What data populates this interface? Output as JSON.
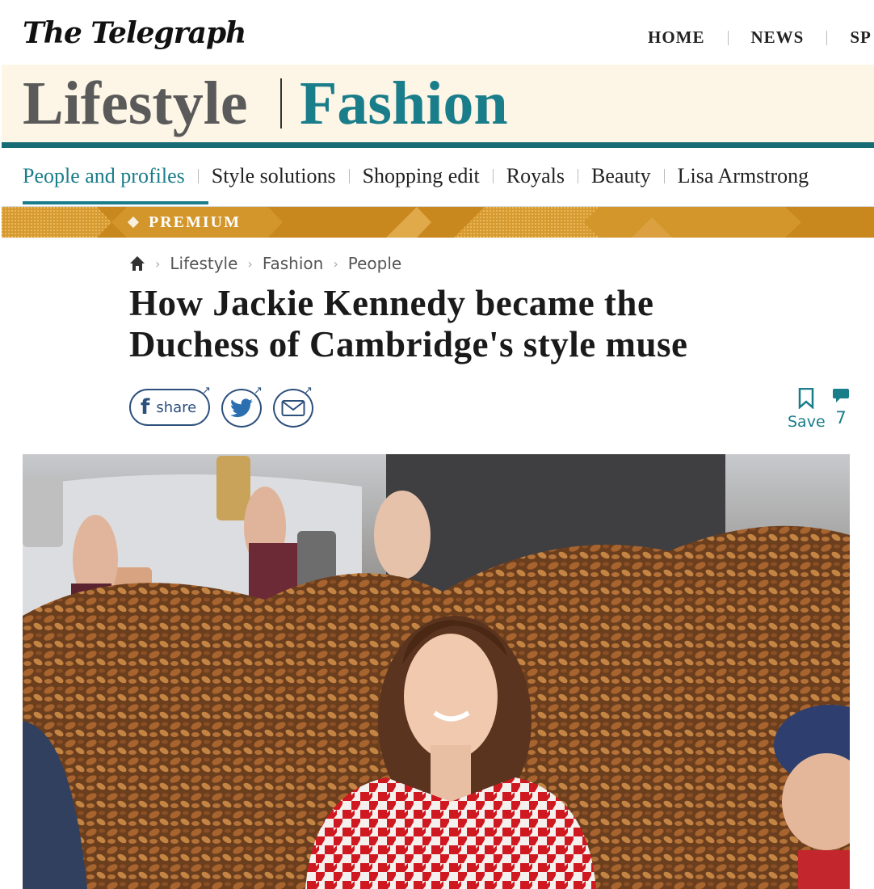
{
  "brand": {
    "logo": "The Telegraph"
  },
  "topnav": {
    "items": [
      "HOME",
      "NEWS",
      "SP"
    ]
  },
  "section": {
    "primary": "Lifestyle",
    "secondary": "Fashion"
  },
  "subnav": {
    "items": [
      "People and profiles",
      "Style solutions",
      "Shopping edit",
      "Royals",
      "Beauty",
      "Lisa Armstrong"
    ],
    "active": "People and profiles"
  },
  "premium": {
    "label": "PREMIUM"
  },
  "breadcrumb": {
    "items": [
      "Lifestyle",
      "Fashion",
      "People"
    ]
  },
  "article": {
    "headline_line1": "How Jackie Kennedy became the",
    "headline_line2": "Duchess of Cambridge's style muse"
  },
  "share": {
    "facebook_label": "share",
    "save_label": "Save",
    "comment_count": "7"
  },
  "colors": {
    "accent": "#1a7d8a",
    "premium": "#c9881e",
    "section_bg": "#fdf5e6",
    "share_blue": "#2c4f7c"
  },
  "icons": [
    "home-icon",
    "facebook-icon",
    "twitter-icon",
    "email-icon",
    "bookmark-icon",
    "comment-icon",
    "external-link-icon"
  ]
}
